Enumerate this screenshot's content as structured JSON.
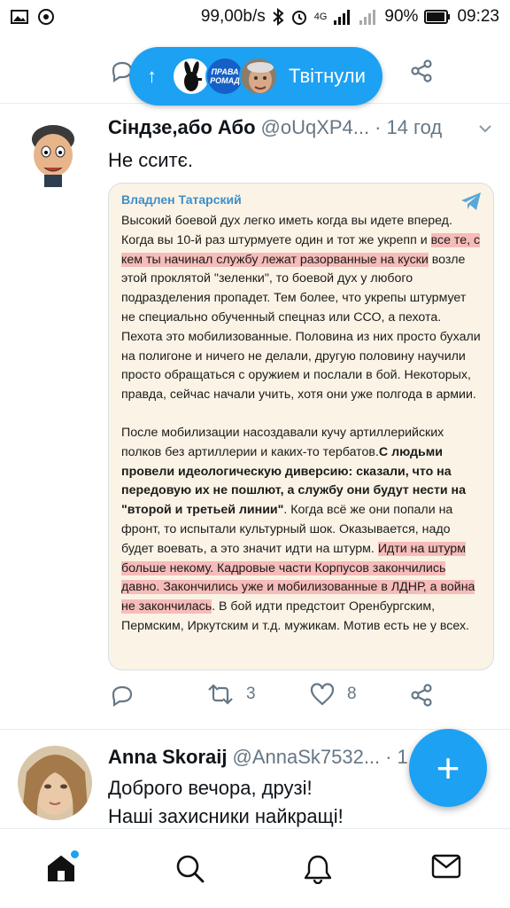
{
  "status_bar": {
    "speed": "99,00b/s",
    "network": "4G",
    "battery": "90%",
    "time": "09:23"
  },
  "pill": {
    "label": "Твітнули",
    "avatar2_text": "ПРАВА РОМАД"
  },
  "tweet1": {
    "name": "Сіндзе,або Або",
    "handle": "@oUqXP4...",
    "time": "14 год",
    "text": "Не сситє.",
    "card": {
      "channel": "Владлен Татарский",
      "p1_a": "Высокий боевой дух легко иметь когда вы идете вперед. Когда вы 10-й раз штурмуете один и тот же укрепп и ",
      "p1_hl": "все те, с кем ты начинал службу лежат разорванные на куски",
      "p1_b": " возле этой проклятой \"зеленки\", то боевой дух у любого подразделения пропадет. Тем более, что укрепы штурмует не специально обученный спецназ или ССО, а пехота. Пехота это мобилизованные. Половина из них просто бухали на полигоне и ничего не делали, другую половину научили просто обращаться с оружием и послали в бой. Некоторых, правда, сейчас начали учить, хотя они уже полгода в армии.",
      "p2_a": "После мобилизации насоздавали кучу артиллерийских полков без артиллерии и каких-то тербатов.",
      "p2_bold": "С людьми провели идеологическую диверсию: сказали, что на передовую их не пошлют, а службу они будут нести на \"второй и третьей линии\"",
      "p2_b": ". Когда всё же они попали на фронт, то испытали культурный шок. Оказывается, надо будет воевать, а это значит идти на штурм. ",
      "p2_hl": "Идти на штурм больше некому. Кадровые части Корпусов закончились давно. Закончились уже и мобилизованные в ЛДНР, а война не закончилась",
      "p2_c": ". В бой идти предстоит Оренбургским, Пермским, Иркутским и т.д. мужикам. Мотив есть не у всех."
    },
    "retweets": "3",
    "likes": "8"
  },
  "tweet2": {
    "name": "Anna Skoraij",
    "handle": "@AnnaSk7532...",
    "time": "1",
    "line1": "Доброго вечора, друзі!",
    "line2": "Наші захисники найкращі!"
  },
  "fab": {
    "label": "+"
  },
  "colors": {
    "accent": "#1da1f2",
    "highlight": "#f08a94",
    "card_bg": "#fbf4e6"
  },
  "icons": [
    "image-icon",
    "whatsapp-icon",
    "bluetooth-icon",
    "alarm-icon",
    "signal-icon",
    "battery-icon",
    "reply-icon",
    "retweet-icon",
    "like-icon",
    "share-icon",
    "home-icon",
    "search-icon",
    "bell-icon",
    "mail-icon",
    "telegram-icon"
  ]
}
